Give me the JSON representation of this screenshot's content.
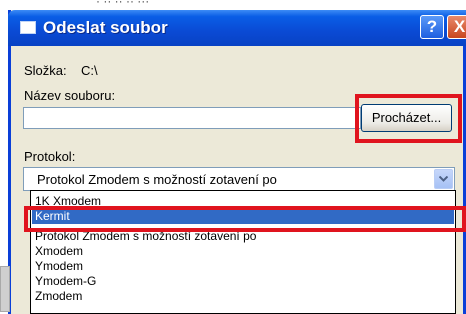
{
  "dialog": {
    "title": "Odeslat soubor",
    "help_button": "?",
    "close_button": "X"
  },
  "folder": {
    "label": "Složka:",
    "value": "C:\\"
  },
  "file_name": {
    "label": "Název souboru:",
    "value": "",
    "browse_button": "Procházet..."
  },
  "protocol": {
    "label": "Protokol:",
    "selected_value": "Protokol Zmodem s možností zotavení po",
    "options": [
      "1K Xmodem",
      "Kermit",
      "Protokol Zmodem s možností zotavení po",
      "Xmodem",
      "Ymodem",
      "Ymodem-G",
      "Zmodem"
    ],
    "highlighted_option": "Kermit"
  },
  "colors": {
    "titlebar": "#0a4ad4",
    "highlight_annotation": "#e0141e",
    "dropdown_selection": "#316ac5"
  }
}
